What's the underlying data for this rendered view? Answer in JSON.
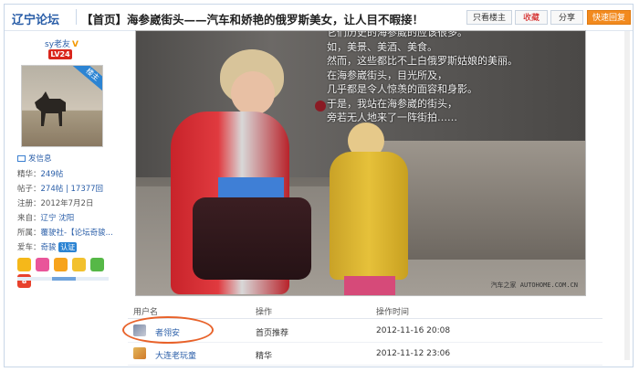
{
  "header": {
    "forum_name": "辽宁论坛",
    "thread_title": "【首页】海参崴街头——汽车和娇艳的俄罗斯美女，让人目不暇接！",
    "buttons": {
      "only_op": "只看楼主",
      "favorite": "收藏",
      "share": "分享",
      "quick_reply": "快速回复"
    }
  },
  "author": {
    "name": "sy老友",
    "verified_mark": "V",
    "level": "LV24",
    "role_tag": "楼主",
    "send_message": "发信息",
    "stats": [
      {
        "key": "精华：",
        "value": "249帖"
      },
      {
        "key": "帖子：",
        "value": "274帖 | 17377回"
      },
      {
        "key": "注册：",
        "value": "2012年7月2日"
      },
      {
        "key": "来自：",
        "value": "辽宁 沈阳"
      },
      {
        "key": "所属：",
        "value": "覆驶社-【论坛奇骏..."
      }
    ],
    "car_label": "爱车：",
    "car_value": "奇骏",
    "car_badge": "认证",
    "medals": [
      "",
      "",
      "",
      "",
      "",
      "8"
    ]
  },
  "photo": {
    "poem": [
      "它们历史的海参崴的应该很多。",
      "如，美景、美酒、美食。",
      "然而，这些都比不上白俄罗斯姑娘的美丽。",
      "在海参崴街头，目光所及，",
      "几乎都是令人惊羡的面容和身影。",
      "于是，我站在海参崴的街头，",
      "旁若无人地来了一阵街拍……"
    ],
    "watermark": "汽车之家  AUTOHOME.COM.CN"
  },
  "log_table": {
    "headers": [
      "用户名",
      "操作",
      "操作时间"
    ],
    "rows": [
      {
        "user": "者翎安",
        "action": "首页推荐",
        "time": "2012-11-16 20:08"
      },
      {
        "user": "大连老玩童",
        "action": "精华",
        "time": "2012-11-12 23:06"
      }
    ]
  },
  "colors": {
    "accent_blue": "#2a5ea8",
    "level_red": "#d9261c",
    "reply_orange": "#f28a1e",
    "highlight_circle": "#e8622a"
  }
}
